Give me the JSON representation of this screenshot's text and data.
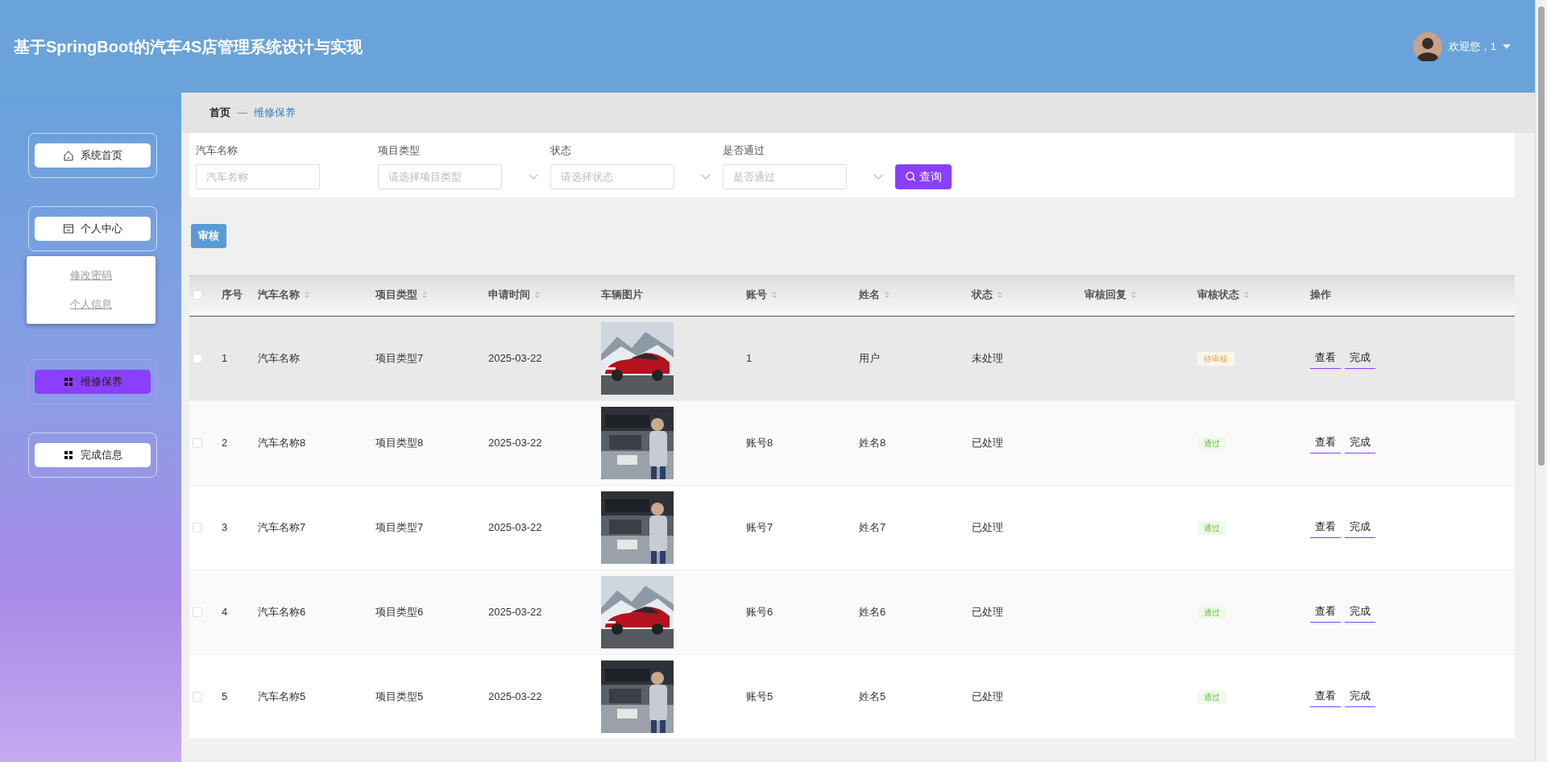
{
  "header": {
    "title": "基于SpringBoot的汽车4S店管理系统设计与实现",
    "user_greeting": "欢迎您，1"
  },
  "sidebar": {
    "items": [
      {
        "label": "系统首页",
        "kind": "home",
        "selected": false
      },
      {
        "label": "个人中心",
        "kind": "panel",
        "selected": false,
        "expanded": true,
        "children": [
          {
            "label": "修改密码"
          },
          {
            "label": "个人信息"
          }
        ]
      },
      {
        "label": "维修保养",
        "kind": "grid",
        "selected": true
      },
      {
        "label": "完成信息",
        "kind": "grid",
        "selected": false
      }
    ]
  },
  "breadcrumb": {
    "home": "首页",
    "separator": "—",
    "current": "维修保养"
  },
  "search": {
    "fields": [
      {
        "label": "汽车名称",
        "kind": "input",
        "placeholder": "汽车名称"
      },
      {
        "label": "项目类型",
        "kind": "select",
        "placeholder": "请选择项目类型"
      },
      {
        "label": "状态",
        "kind": "select",
        "placeholder": "请选择状态"
      },
      {
        "label": "是否通过",
        "kind": "select",
        "placeholder": "是否通过"
      }
    ],
    "button": "查询"
  },
  "toolbar": {
    "audit_button": "审核"
  },
  "table": {
    "header_checkbox": {
      "checked": false
    },
    "columns": [
      {
        "label": "序号",
        "sortable": false
      },
      {
        "label": "汽车名称",
        "sortable": true
      },
      {
        "label": "项目类型",
        "sortable": true
      },
      {
        "label": "申请时间",
        "sortable": true
      },
      {
        "label": "车辆图片",
        "sortable": false
      },
      {
        "label": "账号",
        "sortable": true
      },
      {
        "label": "姓名",
        "sortable": true
      },
      {
        "label": "状态",
        "sortable": true
      },
      {
        "label": "审核回复",
        "sortable": true
      },
      {
        "label": "审核状态",
        "sortable": true
      },
      {
        "label": "操作",
        "sortable": false
      }
    ],
    "rows": [
      {
        "selected": false,
        "hovered": true,
        "no": "1",
        "car": "汽车名称",
        "type": "项目类型7",
        "date": "2025-03-22",
        "account": "1",
        "name": "用户",
        "status": "未处理",
        "audit": {
          "label": "待审核",
          "kind": "pending"
        },
        "actions": [
          "查看",
          "完成"
        ]
      },
      {
        "selected": false,
        "hovered": false,
        "no": "2",
        "car": "汽车名称8",
        "type": "项目类型8",
        "date": "2025-03-22",
        "account": "账号8",
        "name": "姓名8",
        "status": "已处理",
        "audit": {
          "label": "通过",
          "kind": "passed"
        },
        "actions": [
          "查看",
          "完成"
        ]
      },
      {
        "selected": false,
        "hovered": false,
        "no": "3",
        "car": "汽车名称7",
        "type": "项目类型7",
        "date": "2025-03-22",
        "account": "账号7",
        "name": "姓名7",
        "status": "已处理",
        "audit": {
          "label": "通过",
          "kind": "passed"
        },
        "actions": [
          "查看",
          "完成"
        ]
      },
      {
        "selected": false,
        "hovered": false,
        "no": "4",
        "car": "汽车名称6",
        "type": "项目类型6",
        "date": "2025-03-22",
        "account": "账号6",
        "name": "姓名6",
        "status": "已处理",
        "audit": {
          "label": "通过",
          "kind": "passed"
        },
        "actions": [
          "查看",
          "完成"
        ]
      },
      {
        "selected": false,
        "hovered": false,
        "no": "5",
        "car": "汽车名称5",
        "type": "项目类型5",
        "date": "2025-03-22",
        "account": "账号5",
        "name": "姓名5",
        "status": "已处理",
        "audit": {
          "label": "通过",
          "kind": "passed"
        },
        "actions": [
          "查看",
          "完成"
        ]
      }
    ]
  }
}
